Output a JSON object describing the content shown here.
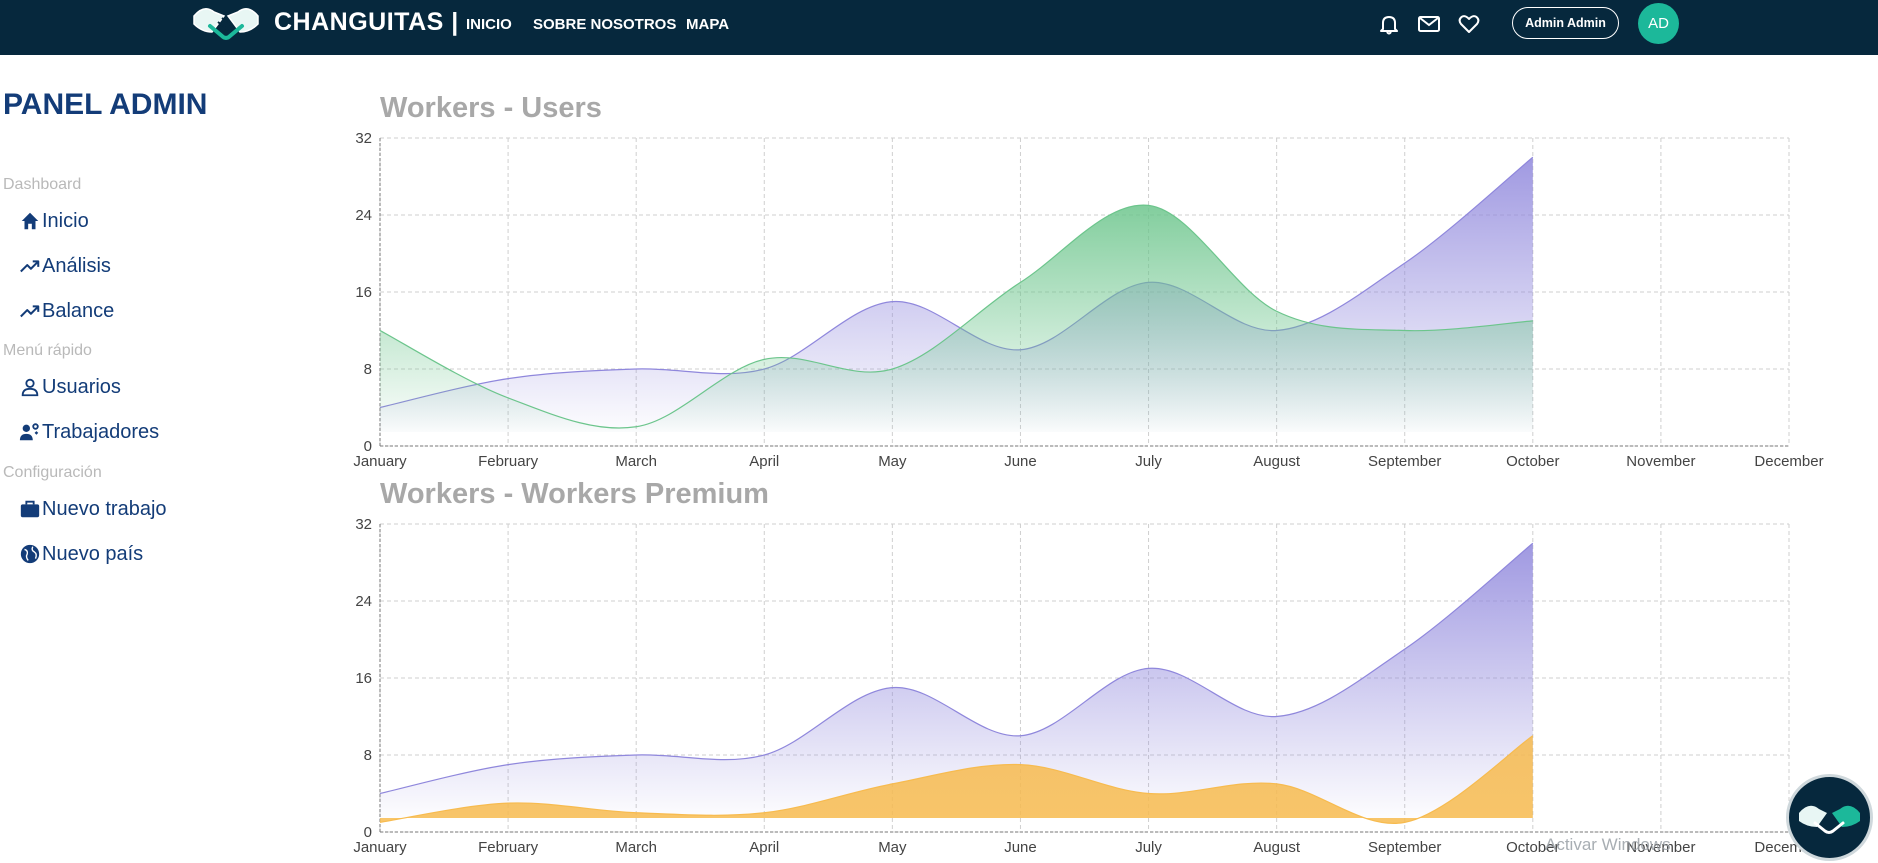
{
  "header": {
    "brand": "CHANGUITAS |",
    "nav": [
      "INICIO",
      "SOBRE NOSOTROS",
      "MAPA"
    ],
    "icons": [
      "bell-icon",
      "mail-icon",
      "heart-icon"
    ],
    "user_button": "Admin Admin",
    "avatar_initials": "AD"
  },
  "sidebar": {
    "title": "PANEL ADMIN",
    "sections": [
      {
        "heading": "Dashboard",
        "items": [
          {
            "label": "Inicio",
            "icon": "home-icon"
          },
          {
            "label": "Análisis",
            "icon": "trend-up-icon"
          },
          {
            "label": "Balance",
            "icon": "trend-up-icon"
          }
        ]
      },
      {
        "heading": "Menú rápido",
        "items": [
          {
            "label": "Usuarios",
            "icon": "user-icon"
          },
          {
            "label": "Trabajadores",
            "icon": "users-cog-icon"
          }
        ]
      },
      {
        "heading": "Configuración",
        "items": [
          {
            "label": "Nuevo trabajo",
            "icon": "briefcase-icon"
          },
          {
            "label": "Nuevo país",
            "icon": "globe-icon"
          }
        ]
      }
    ]
  },
  "colors": {
    "topbar": "#06283d",
    "navy_text": "#133c78",
    "purple": "#8f87dc",
    "green": "#6cc58c",
    "orange": "#f7bb4f",
    "avatar": "#1cb89a"
  },
  "chart_data": [
    {
      "type": "area",
      "title": "Workers - Users",
      "categories": [
        "January",
        "February",
        "March",
        "April",
        "May",
        "June",
        "July",
        "August",
        "September",
        "October",
        "November",
        "December"
      ],
      "ylim": [
        0,
        32
      ],
      "yticks": [
        0,
        8,
        16,
        24,
        32
      ],
      "grid": true,
      "series": [
        {
          "color": "#8f87dc",
          "values": [
            4,
            7,
            8,
            8,
            15,
            10,
            17,
            12,
            19,
            30,
            null,
            null
          ]
        },
        {
          "color": "#6cc58c",
          "values": [
            12,
            5,
            2,
            9,
            8,
            17,
            25,
            14,
            12,
            13,
            null,
            null
          ]
        }
      ]
    },
    {
      "type": "area",
      "title": "Workers - Workers Premium",
      "categories": [
        "January",
        "February",
        "March",
        "April",
        "May",
        "June",
        "July",
        "August",
        "September",
        "October",
        "November",
        "December"
      ],
      "ylim": [
        0,
        32
      ],
      "yticks": [
        0,
        8,
        16,
        24,
        32
      ],
      "grid": true,
      "series": [
        {
          "color": "#8f87dc",
          "values": [
            4,
            7,
            8,
            8,
            15,
            10,
            17,
            12,
            19,
            30,
            null,
            null
          ]
        },
        {
          "color": "#f7bb4f",
          "values": [
            1,
            3,
            2,
            2,
            5,
            7,
            4,
            5,
            1,
            10,
            null,
            null
          ]
        }
      ]
    }
  ],
  "watermark": "Activar Windows"
}
